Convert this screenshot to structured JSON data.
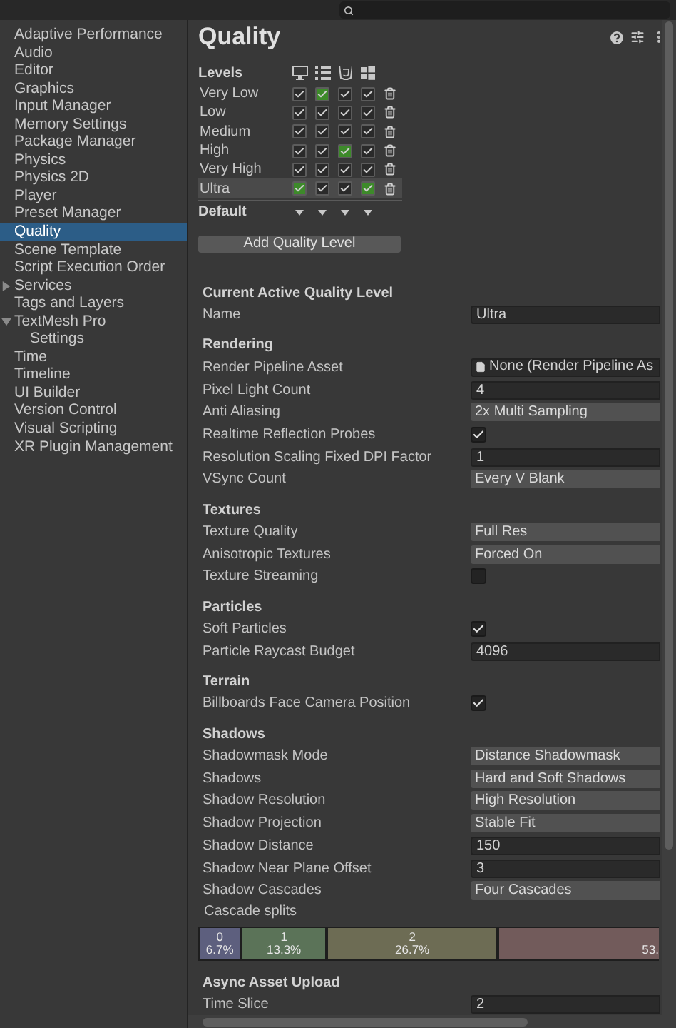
{
  "sidebar": {
    "items": [
      {
        "label": "Adaptive Performance",
        "selected": false
      },
      {
        "label": "Audio",
        "selected": false
      },
      {
        "label": "Editor",
        "selected": false
      },
      {
        "label": "Graphics",
        "selected": false
      },
      {
        "label": "Input Manager",
        "selected": false
      },
      {
        "label": "Memory Settings",
        "selected": false
      },
      {
        "label": "Package Manager",
        "selected": false
      },
      {
        "label": "Physics",
        "selected": false
      },
      {
        "label": "Physics 2D",
        "selected": false
      },
      {
        "label": "Player",
        "selected": false
      },
      {
        "label": "Preset Manager",
        "selected": false
      },
      {
        "label": "Quality",
        "selected": true
      },
      {
        "label": "Scene Template",
        "selected": false
      },
      {
        "label": "Script Execution Order",
        "selected": false
      },
      {
        "label": "Services",
        "selected": false,
        "expanded": false
      },
      {
        "label": "Tags and Layers",
        "selected": false
      },
      {
        "label": "TextMesh Pro",
        "selected": false,
        "expanded": true,
        "children": [
          {
            "label": "Settings",
            "selected": false
          }
        ]
      },
      {
        "label": "Time",
        "selected": false
      },
      {
        "label": "Timeline",
        "selected": false
      },
      {
        "label": "UI Builder",
        "selected": false
      },
      {
        "label": "Version Control",
        "selected": false
      },
      {
        "label": "Visual Scripting",
        "selected": false
      },
      {
        "label": "XR Plugin Management",
        "selected": false
      }
    ]
  },
  "title": "Quality",
  "levels": {
    "heading": "Levels",
    "default_label": "Default",
    "add_button": "Add Quality Level",
    "rows": [
      {
        "name": "Very Low",
        "selected": false,
        "checks": [
          {
            "checked": true,
            "default": false
          },
          {
            "checked": true,
            "default": true
          },
          {
            "checked": true,
            "default": false
          },
          {
            "checked": true,
            "default": false
          }
        ]
      },
      {
        "name": "Low",
        "selected": false,
        "checks": [
          {
            "checked": true,
            "default": false
          },
          {
            "checked": true,
            "default": false
          },
          {
            "checked": true,
            "default": false
          },
          {
            "checked": true,
            "default": false
          }
        ]
      },
      {
        "name": "Medium",
        "selected": false,
        "checks": [
          {
            "checked": true,
            "default": false
          },
          {
            "checked": true,
            "default": false
          },
          {
            "checked": true,
            "default": false
          },
          {
            "checked": true,
            "default": false
          }
        ]
      },
      {
        "name": "High",
        "selected": false,
        "checks": [
          {
            "checked": true,
            "default": false
          },
          {
            "checked": true,
            "default": false
          },
          {
            "checked": true,
            "default": true
          },
          {
            "checked": true,
            "default": false
          }
        ]
      },
      {
        "name": "Very High",
        "selected": false,
        "checks": [
          {
            "checked": true,
            "default": false
          },
          {
            "checked": true,
            "default": false
          },
          {
            "checked": true,
            "default": false
          },
          {
            "checked": true,
            "default": false
          }
        ]
      },
      {
        "name": "Ultra",
        "selected": true,
        "checks": [
          {
            "checked": true,
            "default": true
          },
          {
            "checked": true,
            "default": false
          },
          {
            "checked": true,
            "default": false
          },
          {
            "checked": true,
            "default": true
          }
        ]
      }
    ]
  },
  "sections": [
    {
      "title": "Current Active Quality Level",
      "rows": [
        {
          "label": "Name",
          "kind": "text",
          "value": "Ultra"
        }
      ]
    },
    {
      "title": "Rendering",
      "rows": [
        {
          "label": "Render Pipeline Asset",
          "kind": "object",
          "value": "None (Render Pipeline As"
        },
        {
          "label": "Pixel Light Count",
          "kind": "text",
          "value": "4"
        },
        {
          "label": "Anti Aliasing",
          "kind": "dropdown",
          "value": "2x Multi Sampling"
        },
        {
          "label": "Realtime Reflection Probes",
          "kind": "checkbox",
          "checked": true
        },
        {
          "label": "Resolution Scaling Fixed DPI Factor",
          "kind": "text",
          "value": "1"
        },
        {
          "label": "VSync Count",
          "kind": "dropdown",
          "value": "Every V Blank"
        }
      ]
    },
    {
      "title": "Textures",
      "rows": [
        {
          "label": "Texture Quality",
          "kind": "dropdown",
          "value": "Full Res"
        },
        {
          "label": "Anisotropic Textures",
          "kind": "dropdown",
          "value": "Forced On"
        },
        {
          "label": "Texture Streaming",
          "kind": "checkbox",
          "checked": false
        }
      ]
    },
    {
      "title": "Particles",
      "rows": [
        {
          "label": "Soft Particles",
          "kind": "checkbox",
          "checked": true
        },
        {
          "label": "Particle Raycast Budget",
          "kind": "text",
          "value": "4096"
        }
      ]
    },
    {
      "title": "Terrain",
      "rows": [
        {
          "label": "Billboards Face Camera Position",
          "kind": "checkbox",
          "checked": true
        }
      ]
    },
    {
      "title": "Shadows",
      "rows": [
        {
          "label": "Shadowmask Mode",
          "kind": "dropdown",
          "value": "Distance Shadowmask"
        },
        {
          "label": "Shadows",
          "kind": "dropdown",
          "value": "Hard and Soft Shadows"
        },
        {
          "label": "Shadow Resolution",
          "kind": "dropdown",
          "value": "High Resolution"
        },
        {
          "label": "Shadow Projection",
          "kind": "dropdown",
          "value": "Stable Fit"
        },
        {
          "label": "Shadow Distance",
          "kind": "text",
          "value": "150"
        },
        {
          "label": "Shadow Near Plane Offset",
          "kind": "text",
          "value": "3"
        },
        {
          "label": "Shadow Cascades",
          "kind": "dropdown",
          "value": "Four Cascades"
        }
      ]
    }
  ],
  "cascade_splits": {
    "label": "Cascade splits",
    "segments": [
      {
        "index": "0",
        "percent": "6.7%",
        "level": 0.067,
        "color": "#5d5f7e"
      },
      {
        "index": "1",
        "percent": "13.3%",
        "level": 0.133,
        "color": "#5b7358"
      },
      {
        "index": "2",
        "percent": "26.7%",
        "level": 0.267,
        "color": "#6d6c54"
      },
      {
        "percent": "53.",
        "level": 0.533,
        "color": "#725b5b"
      }
    ]
  },
  "async_section": {
    "title": "Async Asset Upload",
    "rows": [
      {
        "label": "Time Slice",
        "kind": "text",
        "value": "2"
      }
    ]
  }
}
